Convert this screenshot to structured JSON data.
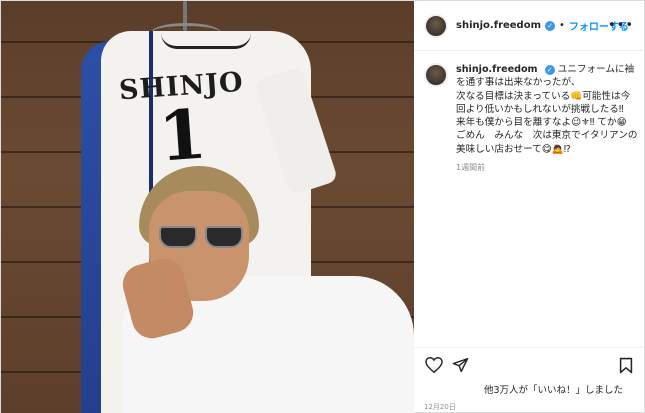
{
  "photo": {
    "jersey_name": "SHINJO",
    "jersey_number": "1"
  },
  "header": {
    "username": "shinjo.freedom",
    "separator": "•",
    "follow_label": "フォローする",
    "more_label": "•••"
  },
  "caption": {
    "username": "shinjo.freedom",
    "line1": "ユニフォームに袖を通す事は出来なかったが、",
    "line2": "次なる目標は決まっている👊可能性は今回より低いかもしれないが挑戦したる‼",
    "line3": "来年も僕から目を離すなよ😉⚜‼ てか😁",
    "line4": "ごめん　みんな　次は東京でイタリアンの美味しい店おせーて😋🙇⁉",
    "time": "1週間前"
  },
  "actions": {
    "likes_text": "他3万人が「いいね！」しました",
    "date": "12月20日"
  },
  "colors": {
    "accent": "#0095f6",
    "verified": "#3897f0"
  }
}
